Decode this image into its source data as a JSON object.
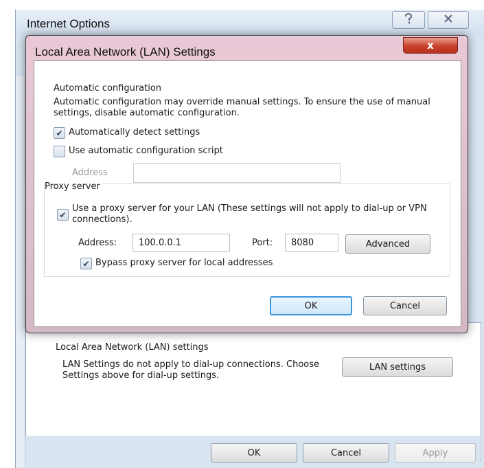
{
  "parent_window": {
    "title": "Internet Options",
    "help_icon": "help-icon",
    "close_icon": "close-icon",
    "lan_group_title": "Local Area Network (LAN) settings",
    "lan_group_desc": "LAN Settings do not apply to dial-up connections. Choose Settings above for dial-up settings.",
    "lan_settings_button": "LAN settings",
    "ok_button": "OK",
    "cancel_button": "Cancel",
    "apply_button": "Apply"
  },
  "dialog": {
    "title": "Local Area Network (LAN) Settings",
    "close_glyph": "x",
    "auto_config": {
      "title": "Automatic configuration",
      "desc": "Automatic configuration may override manual settings.  To ensure the use of manual settings, disable automatic configuration.",
      "detect_label": "Automatically detect settings",
      "detect_checked": true,
      "script_label": "Use automatic configuration script",
      "script_checked": false,
      "address_label": "Address",
      "address_value": ""
    },
    "proxy": {
      "title": "Proxy server",
      "use_proxy_label": "Use a proxy server for your LAN (These settings will not apply to dial-up or VPN connections).",
      "use_proxy_checked": true,
      "address_label": "Address:",
      "address_value": "100.0.0.1",
      "port_label": "Port:",
      "port_value": "8080",
      "advanced_button": "Advanced",
      "bypass_label": "Bypass proxy server for local addresses",
      "bypass_checked": true
    },
    "ok_button": "OK",
    "cancel_button": "Cancel"
  },
  "colors": {
    "dialog_frame": "#e0c2cf",
    "close_button": "#c7422c",
    "parent_frame": "#d9e4f1",
    "focus_border": "#3d95dc"
  }
}
